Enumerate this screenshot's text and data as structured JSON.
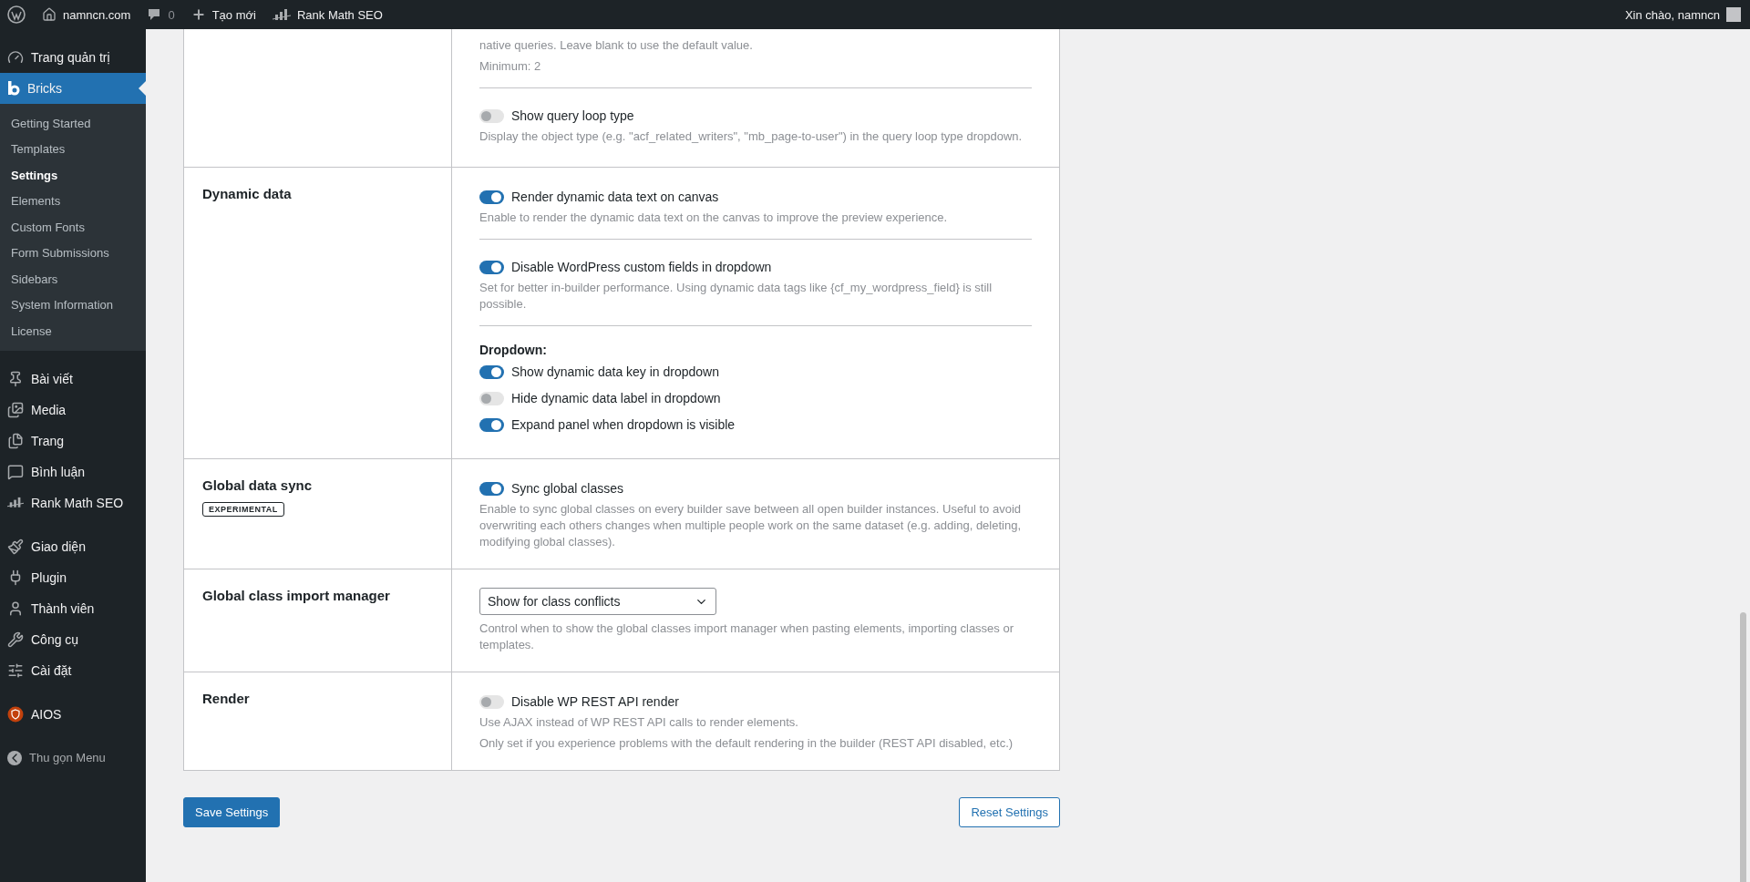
{
  "admin_bar": {
    "site": "namncn.com",
    "comments": "0",
    "new": "Tạo mới",
    "seo": "Rank Math SEO",
    "greeting": "Xin chào, namncn"
  },
  "sidebar": {
    "groups": [
      [
        {
          "label": "Trang quản trị",
          "selected": false
        },
        {
          "label": "Bricks",
          "selected": true,
          "children": [
            {
              "label": "Getting Started",
              "selected": false
            },
            {
              "label": "Templates",
              "selected": false
            },
            {
              "label": "Settings",
              "selected": true
            },
            {
              "label": "Elements",
              "selected": false
            },
            {
              "label": "Custom Fonts",
              "selected": false
            },
            {
              "label": "Form Submissions",
              "selected": false
            },
            {
              "label": "Sidebars",
              "selected": false
            },
            {
              "label": "System Information",
              "selected": false
            },
            {
              "label": "License",
              "selected": false
            }
          ]
        }
      ],
      [
        {
          "label": "Bài viết",
          "selected": false
        },
        {
          "label": "Media",
          "selected": false
        },
        {
          "label": "Trang",
          "selected": false
        },
        {
          "label": "Bình luận",
          "selected": false
        },
        {
          "label": "Rank Math SEO",
          "selected": false
        }
      ],
      [
        {
          "label": "Giao diện",
          "selected": false
        },
        {
          "label": "Plugin",
          "selected": false
        },
        {
          "label": "Thành viên",
          "selected": false
        },
        {
          "label": "Công cụ",
          "selected": false
        },
        {
          "label": "Cài đặt",
          "selected": false
        }
      ],
      [
        {
          "label": "AIOS",
          "selected": false
        }
      ]
    ],
    "collapse": "Thu gọn Menu"
  },
  "sections": [
    {
      "items": [
        {
          "kind": "text",
          "text": "native queries. Leave blank to use the default value."
        },
        {
          "kind": "text",
          "text": "Minimum: 2"
        },
        {
          "kind": "divider"
        },
        {
          "kind": "toggle",
          "label": "Show query loop type",
          "on": false,
          "description": "Display the object type (e.g. \"acf_related_writers\", \"mb_page-to-user\") in the query loop type dropdown."
        }
      ]
    },
    {
      "title": "Dynamic data",
      "items": [
        {
          "kind": "toggle",
          "label": "Render dynamic data text on canvas",
          "on": true,
          "description": "Enable to render the dynamic data text on the canvas to improve the preview experience."
        },
        {
          "kind": "divider"
        },
        {
          "kind": "toggle",
          "label": "Disable WordPress custom fields in dropdown",
          "on": true,
          "description": "Set for better in-builder performance. Using dynamic data tags like {cf_my_wordpress_field} is still possible."
        },
        {
          "kind": "divider"
        },
        {
          "kind": "heading",
          "text": "Dropdown:"
        },
        {
          "kind": "toggle",
          "label": "Show dynamic data key in dropdown",
          "on": true
        },
        {
          "kind": "toggle",
          "label": "Hide dynamic data label in dropdown",
          "on": false
        },
        {
          "kind": "toggle",
          "label": "Expand panel when dropdown is visible",
          "on": true
        }
      ]
    },
    {
      "title": "Global data sync",
      "badge": "EXPERIMENTAL",
      "items": [
        {
          "kind": "toggle",
          "label": "Sync global classes",
          "on": true,
          "description": "Enable to sync global classes on every builder save between all open builder instances. Useful to avoid overwriting each others changes when multiple people work on the same dataset (e.g. adding, deleting, modifying global classes)."
        }
      ]
    },
    {
      "title": "Global class import manager",
      "items": [
        {
          "kind": "select",
          "value": "Show for class conflicts",
          "description": "Control when to show the global classes import manager when pasting elements, importing classes or templates."
        }
      ]
    },
    {
      "title": "Render",
      "items": [
        {
          "kind": "toggle",
          "label": "Disable WP REST API render",
          "on": false,
          "description": "Use AJAX instead of WP REST API calls to render elements."
        },
        {
          "kind": "text",
          "text": "Only set if you experience problems with the default rendering in the builder (REST API disabled, etc.)"
        }
      ]
    }
  ],
  "buttons": {
    "save": "Save Settings",
    "reset": "Reset Settings"
  }
}
